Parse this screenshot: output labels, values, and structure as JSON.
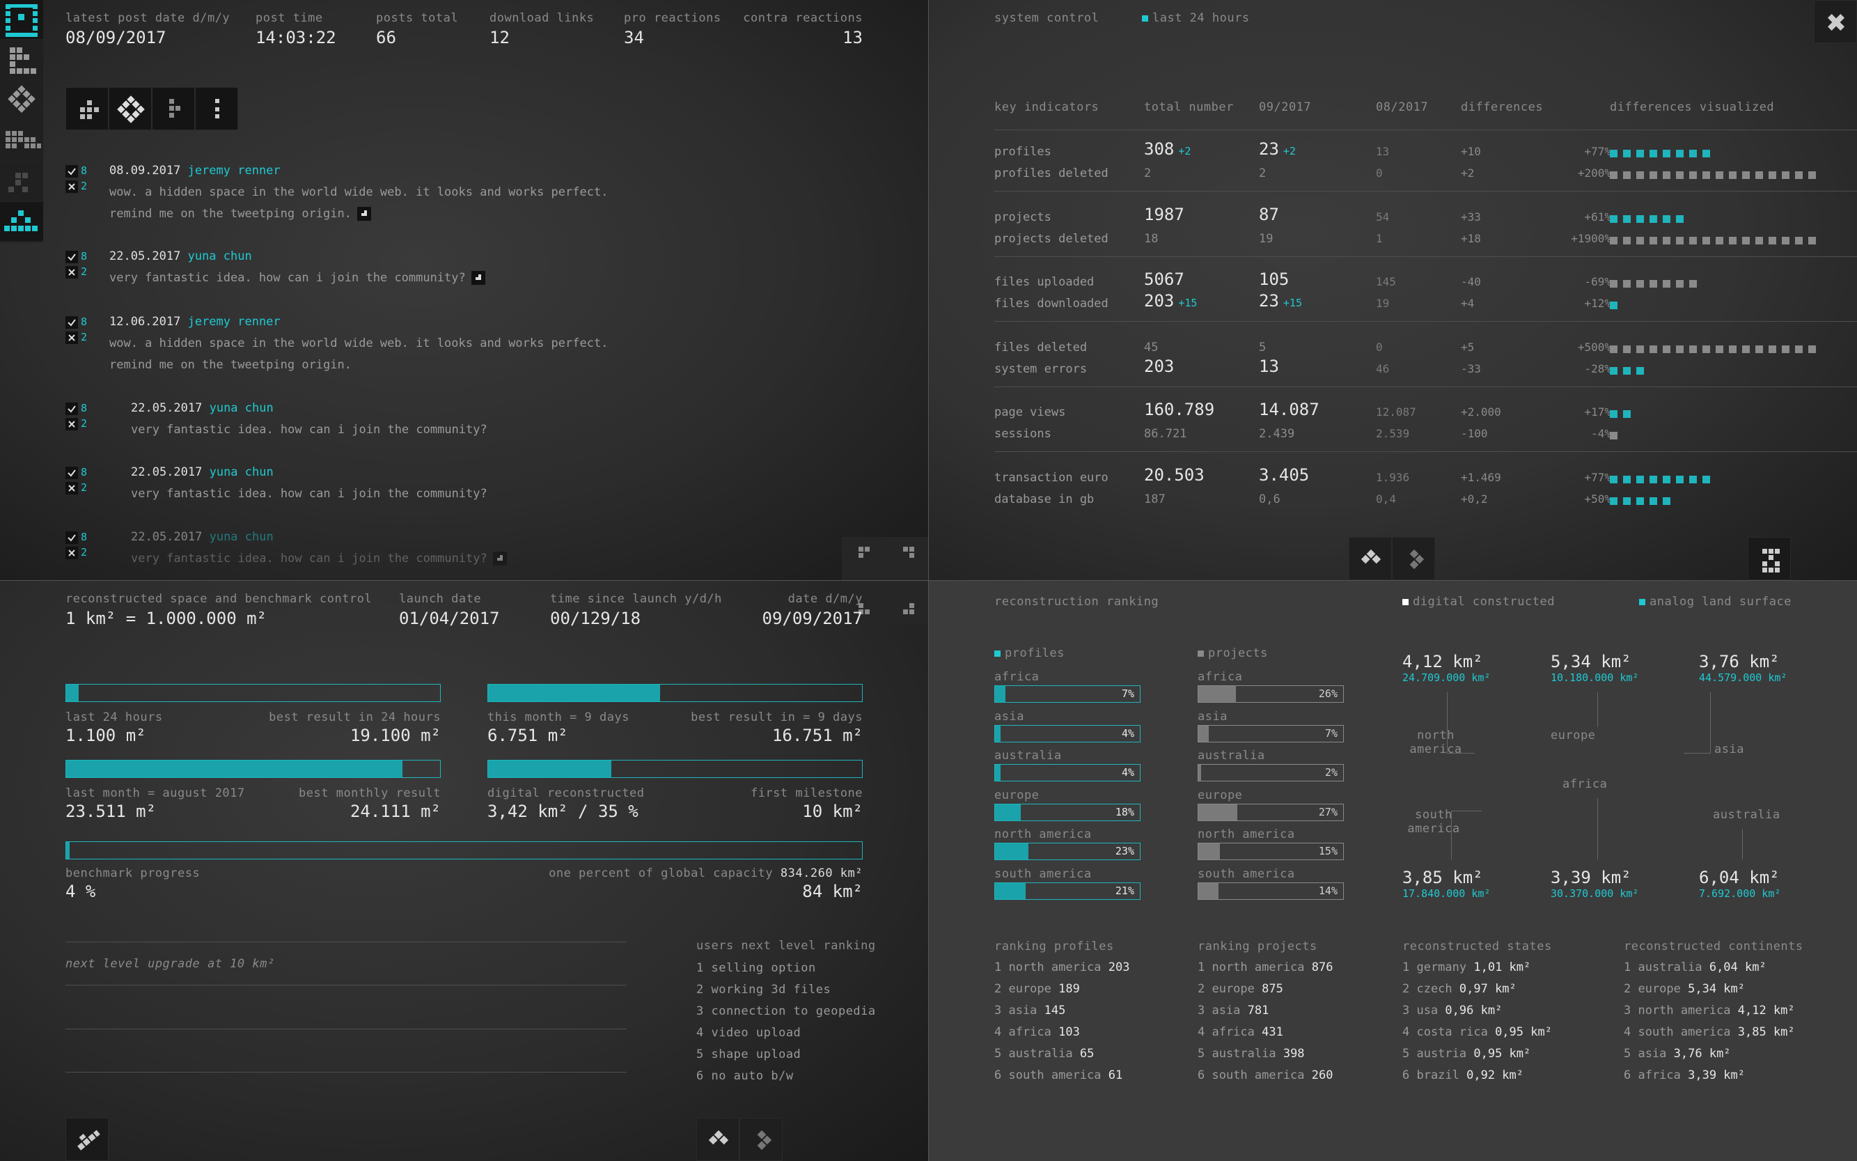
{
  "colors": {
    "accent": "#1fc9d2",
    "bar_fill": "#1aa3aa",
    "grey_bar": "#7a7a7a"
  },
  "sidebar": {
    "icons": [
      "pixel-smiley-icon",
      "pixel-blocks-icon",
      "pixel-diamond-icon",
      "pixel-grid-icon",
      "pixel-dim-icon",
      "pixel-cyan-icon"
    ]
  },
  "stats": {
    "latest_post_date_label": "latest post date d/m/y",
    "latest_post_date": "08/09/2017",
    "post_time_label": "post time",
    "post_time": "14:03:22",
    "posts_total_label": "posts total",
    "posts_total": "66",
    "download_links_label": "download links",
    "download_links": "12",
    "pro_reactions_label": "pro reactions",
    "pro_reactions": "34",
    "contra_reactions_label": "contra reactions",
    "contra_reactions": "13"
  },
  "posts": [
    {
      "date": "08.09.2017",
      "author": "jeremy renner",
      "line1": "wow. a hidden space in the world wide web. it looks and works perfect.",
      "line2": "remind me on the tweetping origin.",
      "pro": "8",
      "contra": "2"
    },
    {
      "date": "22.05.2017",
      "author": "yuna chun",
      "line1": "very fantastic idea. how can i join the community?",
      "line2": "",
      "pro": "8",
      "contra": "2"
    },
    {
      "date": "12.06.2017",
      "author": "jeremy renner",
      "line1": "wow. a hidden space in the world wide web. it looks and works perfect.",
      "line2": "remind me on the tweetping origin.",
      "pro": "8",
      "contra": "2"
    },
    {
      "date": "22.05.2017",
      "author": "yuna chun",
      "line1": "very fantastic idea. how can i join the community?",
      "line2": "",
      "pro": "8",
      "contra": "2"
    },
    {
      "date": "22.05.2017",
      "author": "yuna chun",
      "line1": "very fantastic idea. how can i join the community?",
      "line2": "",
      "pro": "8",
      "contra": "2"
    },
    {
      "date": "22.05.2017",
      "author": "yuna chun",
      "line1": "very fantastic idea. how can i join the community?",
      "line2": "",
      "pro": "8",
      "contra": "2"
    }
  ],
  "system": {
    "title": "system control",
    "filter": "last 24 hours",
    "headers": [
      "key indicators",
      "total number",
      "09/2017",
      "08/2017",
      "differences",
      "differences visualized"
    ],
    "rows": [
      {
        "name": "profiles",
        "total": "308",
        "total_delta": "+2",
        "month": "23",
        "month_delta": "+2",
        "prev": "13",
        "diff": "+10",
        "pct": "+77%",
        "squares": 8,
        "cyan": true,
        "big": true
      },
      {
        "name": "profiles deleted",
        "total": "2",
        "total_delta": "",
        "month": "2",
        "month_delta": "",
        "prev": "0",
        "diff": "+2",
        "pct": "+200%",
        "squares": 16,
        "cyan": false,
        "big": false
      },
      {
        "name": "projects",
        "total": "1987",
        "total_delta": "",
        "month": "87",
        "month_delta": "",
        "prev": "54",
        "diff": "+33",
        "pct": "+61%",
        "squares": 6,
        "cyan": true,
        "big": true
      },
      {
        "name": "projects deleted",
        "total": "18",
        "total_delta": "",
        "month": "19",
        "month_delta": "",
        "prev": "1",
        "diff": "+18",
        "pct": "+1900%",
        "squares": 16,
        "cyan": false,
        "big": false
      },
      {
        "name": "files uploaded",
        "total": "5067",
        "total_delta": "",
        "month": "105",
        "month_delta": "",
        "prev": "145",
        "diff": "-40",
        "pct": "-69%",
        "squares": 7,
        "cyan": false,
        "big": true
      },
      {
        "name": "files downloaded",
        "total": "203",
        "total_delta": "+15",
        "month": "23",
        "month_delta": "+15",
        "prev": "19",
        "diff": "+4",
        "pct": "+12%",
        "squares": 1,
        "cyan": true,
        "big": true
      },
      {
        "name": "files deleted",
        "total": "45",
        "total_delta": "",
        "month": "5",
        "month_delta": "",
        "prev": "0",
        "diff": "+5",
        "pct": "+500%",
        "squares": 16,
        "cyan": false,
        "big": false
      },
      {
        "name": "system errors",
        "total": "203",
        "total_delta": "",
        "month": "13",
        "month_delta": "",
        "prev": "46",
        "diff": "-33",
        "pct": "-28%",
        "squares": 3,
        "cyan": true,
        "big": true
      },
      {
        "name": "page views",
        "total": "160.789",
        "total_delta": "",
        "month": "14.087",
        "month_delta": "",
        "prev": "12.087",
        "diff": "+2.000",
        "pct": "+17%",
        "squares": 2,
        "cyan": true,
        "big": true
      },
      {
        "name": "sessions",
        "total": "86.721",
        "total_delta": "",
        "month": "2.439",
        "month_delta": "",
        "prev": "2.539",
        "diff": "-100",
        "pct": "-4%",
        "squares": 1,
        "cyan": false,
        "big": false
      },
      {
        "name": "transaction euro",
        "total": "20.503",
        "total_delta": "",
        "month": "3.405",
        "month_delta": "",
        "prev": "1.936",
        "diff": "+1.469",
        "pct": "+77%",
        "squares": 8,
        "cyan": true,
        "big": true
      },
      {
        "name": "database in gb",
        "total": "187",
        "total_delta": "",
        "month": "0,6",
        "month_delta": "",
        "prev": "0,4",
        "diff": "+0,2",
        "pct": "+50%",
        "squares": 5,
        "cyan": true,
        "big": false
      }
    ]
  },
  "bench": {
    "title": "reconstructed space and benchmark control",
    "unit": "1 km² = 1.000.000 m²",
    "launch_label": "launch date",
    "launch": "01/04/2017",
    "since_label": "time since launch y/d/h",
    "since": "00/129/18",
    "date_label": "date d/m/y",
    "date": "09/09/2017",
    "bars": [
      {
        "l_label": "last 24 hours",
        "r_label": "best result in 24 hours",
        "l_val": "1.100 m²",
        "r_val": "19.100 m²",
        "fill": 0.034
      },
      {
        "l_label": "this month = 9 days",
        "r_label": "best result in = 9 days",
        "l_val": "6.751 m²",
        "r_val": "16.751 m²",
        "fill": 0.46
      },
      {
        "l_label": "last month = august 2017",
        "r_label": "best monthly result",
        "l_val": "23.511 m²",
        "r_val": "24.111 m²",
        "fill": 0.9
      },
      {
        "l_label": "digital reconstructed",
        "r_label": "first milestone",
        "l_val": "3,42 km² / 35 %",
        "r_val": "10 km²",
        "fill": 0.33
      }
    ],
    "benchmark_label": "benchmark progress",
    "benchmark_val": "4 %",
    "benchmark_fill": 0.004,
    "capacity_label": "one percent of global capacity",
    "capacity_sup": "834.260 km²",
    "capacity_val": "84 km²",
    "next_level": "next level upgrade at 10 km²",
    "ranking_title": "users next level ranking",
    "ranking": [
      "1 selling option",
      "2 working 3d files",
      "3 connection to geopedia",
      "4 video upload",
      "5 shape upload",
      "6 no auto b/w"
    ]
  },
  "recon": {
    "title": "reconstruction ranking",
    "legend_digital": "digital constructed",
    "legend_analog": "analog land surface",
    "profiles_title": "profiles",
    "projects_title": "projects",
    "profiles": [
      {
        "name": "africa",
        "pct": "7%",
        "v": 0.07
      },
      {
        "name": "asia",
        "pct": "4%",
        "v": 0.04
      },
      {
        "name": "australia",
        "pct": "4%",
        "v": 0.04
      },
      {
        "name": "europe",
        "pct": "18%",
        "v": 0.18
      },
      {
        "name": "north america",
        "pct": "23%",
        "v": 0.23
      },
      {
        "name": "south america",
        "pct": "21%",
        "v": 0.21
      }
    ],
    "projects": [
      {
        "name": "africa",
        "pct": "26%",
        "v": 0.26
      },
      {
        "name": "asia",
        "pct": "7%",
        "v": 0.07
      },
      {
        "name": "australia",
        "pct": "2%",
        "v": 0.02
      },
      {
        "name": "europe",
        "pct": "27%",
        "v": 0.27
      },
      {
        "name": "north america",
        "pct": "15%",
        "v": 0.15
      },
      {
        "name": "south america",
        "pct": "14%",
        "v": 0.14
      }
    ],
    "continents": {
      "na": {
        "val": "4,12 km²",
        "sub": "24.709.000 km²",
        "label": "north america"
      },
      "eu": {
        "val": "5,34 km²",
        "sub": "10.180.000 km²",
        "label": "europe"
      },
      "as": {
        "val": "3,76 km²",
        "sub": "44.579.000 km²",
        "label": "asia"
      },
      "sa": {
        "val": "3,85 km²",
        "sub": "17.840.000 km²",
        "label": "south america"
      },
      "af": {
        "val": "3,39 km²",
        "sub": "30.370.000 km²",
        "label": "africa"
      },
      "au": {
        "val": "6,04 km²",
        "sub": "7.692.000 km²",
        "label": "australia"
      }
    },
    "rank_profiles_title": "ranking profiles",
    "rank_profiles": [
      [
        "1 north america",
        "203"
      ],
      [
        "2 europe",
        "189"
      ],
      [
        "3 asia",
        "145"
      ],
      [
        "4 africa",
        "103"
      ],
      [
        "5 australia",
        "65"
      ],
      [
        "6 south america",
        "61"
      ]
    ],
    "rank_projects_title": "ranking projects",
    "rank_projects": [
      [
        "1 north america",
        "876"
      ],
      [
        "2 europe",
        "875"
      ],
      [
        "3 asia",
        "781"
      ],
      [
        "4 africa",
        "431"
      ],
      [
        "5 australia",
        "398"
      ],
      [
        "6 south america",
        "260"
      ]
    ],
    "states_title": "reconstructed states",
    "states": [
      [
        "1 germany",
        "1,01 km²"
      ],
      [
        "2 czech",
        "0,97 km²"
      ],
      [
        "3 usa",
        "0,96 km²"
      ],
      [
        "4 costa rica",
        "0,95 km²"
      ],
      [
        "5 austria",
        "0,95 km²"
      ],
      [
        "6 brazil",
        "0,92 km²"
      ]
    ],
    "cont_title": "reconstructed continents",
    "cont": [
      [
        "1 australia",
        "6,04 km²"
      ],
      [
        "2 europe",
        "5,34 km²"
      ],
      [
        "3 north america",
        "4,12 km²"
      ],
      [
        "4 south america",
        "3,85 km²"
      ],
      [
        "5 asia",
        "3,76 km²"
      ],
      [
        "6 africa",
        "3,39 km²"
      ]
    ]
  }
}
